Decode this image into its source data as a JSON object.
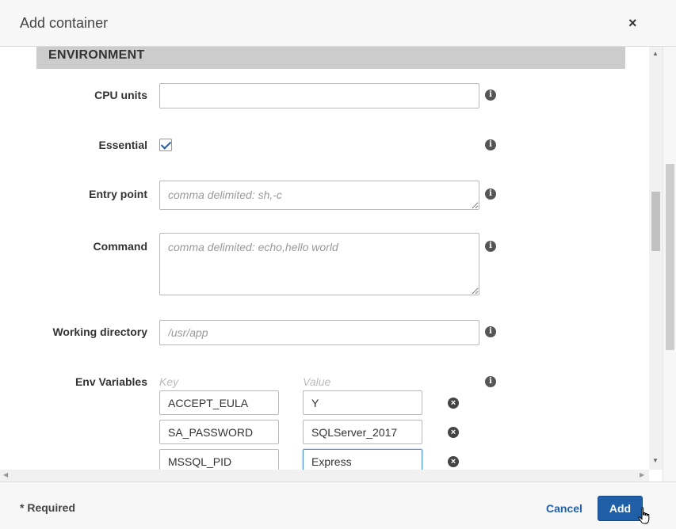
{
  "dialog": {
    "title": "Add container",
    "close_glyph": "×"
  },
  "section": {
    "title": "ENVIRONMENT"
  },
  "fields": {
    "cpu_units": {
      "label": "CPU units",
      "value": ""
    },
    "essential": {
      "label": "Essential",
      "checked": true
    },
    "entry_point": {
      "label": "Entry point",
      "placeholder": "comma delimited: sh,-c"
    },
    "command": {
      "label": "Command",
      "placeholder": "comma delimited: echo,hello world"
    },
    "working_directory": {
      "label": "Working directory",
      "placeholder": "/usr/app"
    }
  },
  "env": {
    "label": "Env Variables",
    "key_header": "Key",
    "value_header": "Value",
    "rows": [
      {
        "key": "ACCEPT_EULA",
        "value": "Y"
      },
      {
        "key": "SA_PASSWORD",
        "value": "SQLServer_2017"
      },
      {
        "key": "MSSQL_PID",
        "value": "Express"
      }
    ]
  },
  "footer": {
    "required_note": "* Required",
    "cancel_label": "Cancel",
    "add_label": "Add"
  },
  "icons": {
    "info": "info-icon",
    "remove": "remove-circle-icon",
    "close": "close-icon",
    "cursor": "hand-pointer-icon"
  },
  "colors": {
    "primary": "#1f5fa8",
    "section_bg": "#cccccc"
  }
}
